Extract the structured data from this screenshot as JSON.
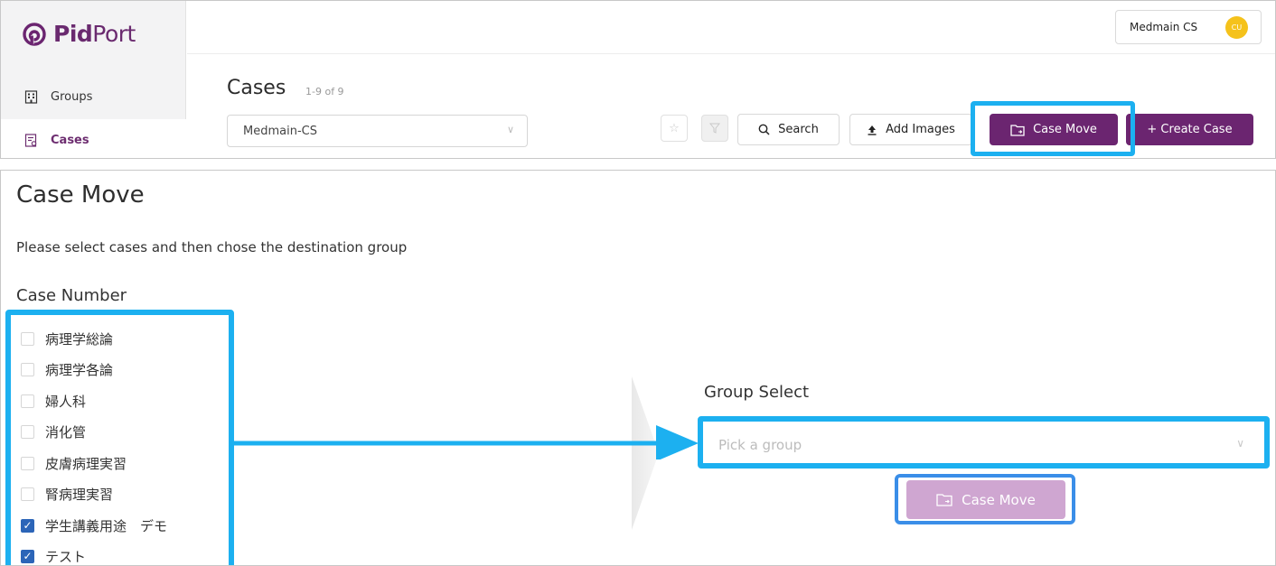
{
  "app": {
    "logo_bold": "Pid",
    "logo_light": "Port",
    "brand_color": "#6b2570"
  },
  "sidebar": {
    "items": [
      {
        "label": "Groups",
        "icon": "building-icon",
        "active": false
      },
      {
        "label": "Cases",
        "icon": "case-list-icon",
        "active": true
      }
    ]
  },
  "header": {
    "user_name": "Medmain CS",
    "avatar_initials": "CU"
  },
  "cases_page": {
    "title": "Cases",
    "count": "1-9 of 9",
    "group_value": "Medmain-CS",
    "toolbar": {
      "search_label": "Search",
      "add_images_label": "Add Images",
      "case_move_label": "Case Move",
      "create_case_label": "+ Create Case"
    }
  },
  "case_move": {
    "title": "Case Move",
    "description": "Please select cases and then chose the destination group",
    "case_number_label": "Case Number",
    "cases": [
      {
        "label": "病理学総論",
        "checked": false
      },
      {
        "label": "病理学各論",
        "checked": false
      },
      {
        "label": "婦人科",
        "checked": false
      },
      {
        "label": "消化管",
        "checked": false
      },
      {
        "label": "皮膚病理実習",
        "checked": false
      },
      {
        "label": "腎病理実習",
        "checked": false
      },
      {
        "label": "学生講義用途　デモ",
        "checked": true
      },
      {
        "label": "テスト",
        "checked": true
      }
    ],
    "group_select_label": "Group Select",
    "group_placeholder": "Pick a group",
    "move_button_label": "Case Move"
  },
  "colors": {
    "highlight": "#1cb0f0",
    "highlight_secondary": "#3a8ee8",
    "checkbox_checked": "#2c65b8",
    "move_button_disabled": "#cfa6d1"
  }
}
